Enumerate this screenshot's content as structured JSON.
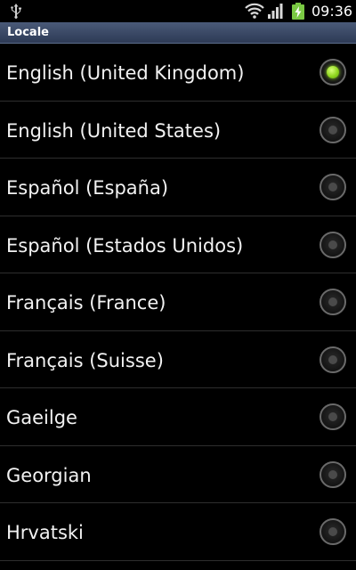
{
  "status_bar": {
    "time": "09:36",
    "icons": [
      "usb-icon",
      "wifi-icon",
      "signal-icon",
      "battery-charging-icon"
    ]
  },
  "title_bar": {
    "title": "Locale"
  },
  "colors": {
    "title_bar": "#3a4866",
    "radio_checked": "#8fd61e",
    "background": "#000000"
  },
  "locales": [
    {
      "label": "English (United Kingdom)",
      "selected": true
    },
    {
      "label": "English (United States)",
      "selected": false
    },
    {
      "label": "Español (España)",
      "selected": false
    },
    {
      "label": "Español (Estados Unidos)",
      "selected": false
    },
    {
      "label": "Français (France)",
      "selected": false
    },
    {
      "label": "Français (Suisse)",
      "selected": false
    },
    {
      "label": "Gaeilge",
      "selected": false
    },
    {
      "label": "Georgian",
      "selected": false
    },
    {
      "label": "Hrvatski",
      "selected": false
    }
  ]
}
